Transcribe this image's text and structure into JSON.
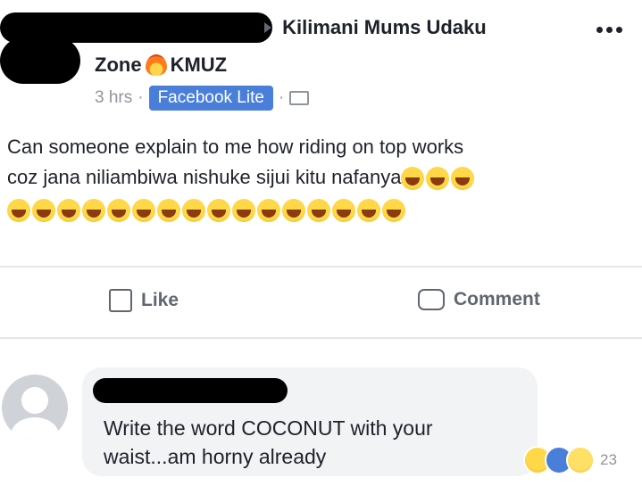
{
  "post": {
    "group_line1": "Kilimani Mums Udaku",
    "group_line2_part1": "Zone",
    "group_line2_part2": "KMUZ",
    "time": "3 hrs",
    "separator": "·",
    "app_badge": "Facebook Lite",
    "text_line1": "Can someone explain to me how riding on top works",
    "text_line2": "coz jana niliambiwa nishuke sijui kitu nafanya",
    "emojis_line2": 3,
    "emojis_line3": 16
  },
  "actions": {
    "like_label": "Like",
    "comment_label": "Comment"
  },
  "comment": {
    "text": "Write the word COCONUT with your waist...am horny already",
    "reaction_count": "23"
  },
  "colors": {
    "badge": "#4a7fd9",
    "muted": "#90949c",
    "text": "#1d2129"
  }
}
